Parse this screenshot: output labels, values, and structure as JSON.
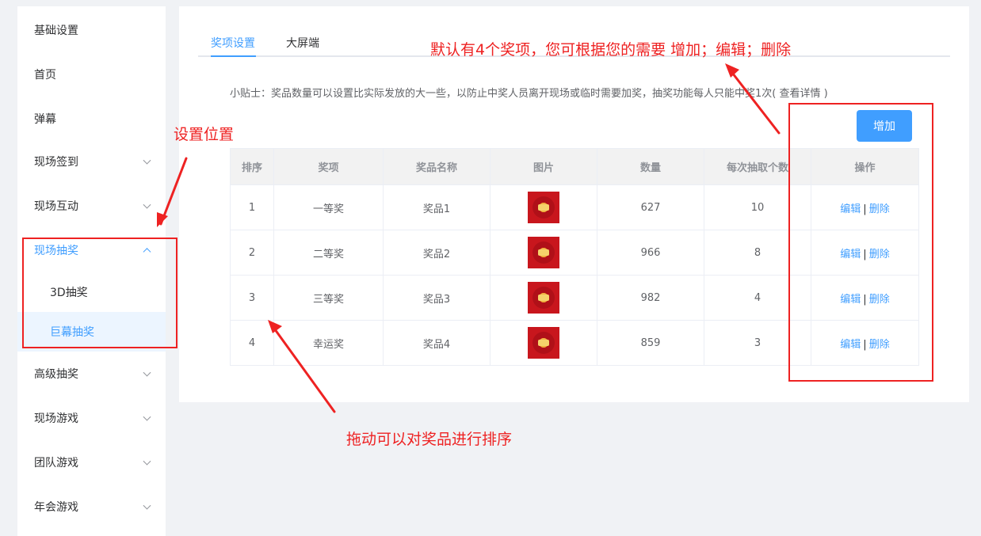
{
  "sidebar": {
    "items": [
      {
        "label": "基础设置"
      },
      {
        "label": "首页"
      },
      {
        "label": "弹幕"
      },
      {
        "label": "现场签到"
      },
      {
        "label": "现场互动"
      },
      {
        "label": "现场抽奖"
      },
      {
        "label": "3D抽奖"
      },
      {
        "label": "巨幕抽奖"
      },
      {
        "label": "高级抽奖"
      },
      {
        "label": "现场游戏"
      },
      {
        "label": "团队游戏"
      },
      {
        "label": "年会游戏"
      }
    ]
  },
  "tabs": [
    {
      "label": "奖项设置",
      "active": true
    },
    {
      "label": "大屏端",
      "active": false
    }
  ],
  "tip": {
    "text": "小贴士：奖品数量可以设置比实际发放的大一些，以防止中奖人员离开现场或临时需要加奖，抽奖功能每人只能中奖1次",
    "link": "( 查看详情 )"
  },
  "add_button": "增加",
  "table": {
    "headers": [
      "排序",
      "奖项",
      "奖品名称",
      "图片",
      "数量",
      "每次抽取个数",
      "操作"
    ],
    "rows": [
      {
        "order": "1",
        "award": "一等奖",
        "prize": "奖品1",
        "quantity": "627",
        "per_draw": "10"
      },
      {
        "order": "2",
        "award": "二等奖",
        "prize": "奖品2",
        "quantity": "966",
        "per_draw": "8"
      },
      {
        "order": "3",
        "award": "三等奖",
        "prize": "奖品3",
        "quantity": "982",
        "per_draw": "4"
      },
      {
        "order": "4",
        "award": "幸运奖",
        "prize": "奖品4",
        "quantity": "859",
        "per_draw": "3"
      }
    ],
    "edit_label": "编辑",
    "separator": "|",
    "delete_label": "删除"
  },
  "annotations": {
    "top": "默认有4个奖项，您可根据您的需要 增加；编辑；删除",
    "left": "设置位置",
    "bottom": "拖动可以对奖品进行排序"
  },
  "colors": {
    "accent": "#409eff",
    "annotation": "#ee2222",
    "selected_bg": "#ecf5ff"
  }
}
